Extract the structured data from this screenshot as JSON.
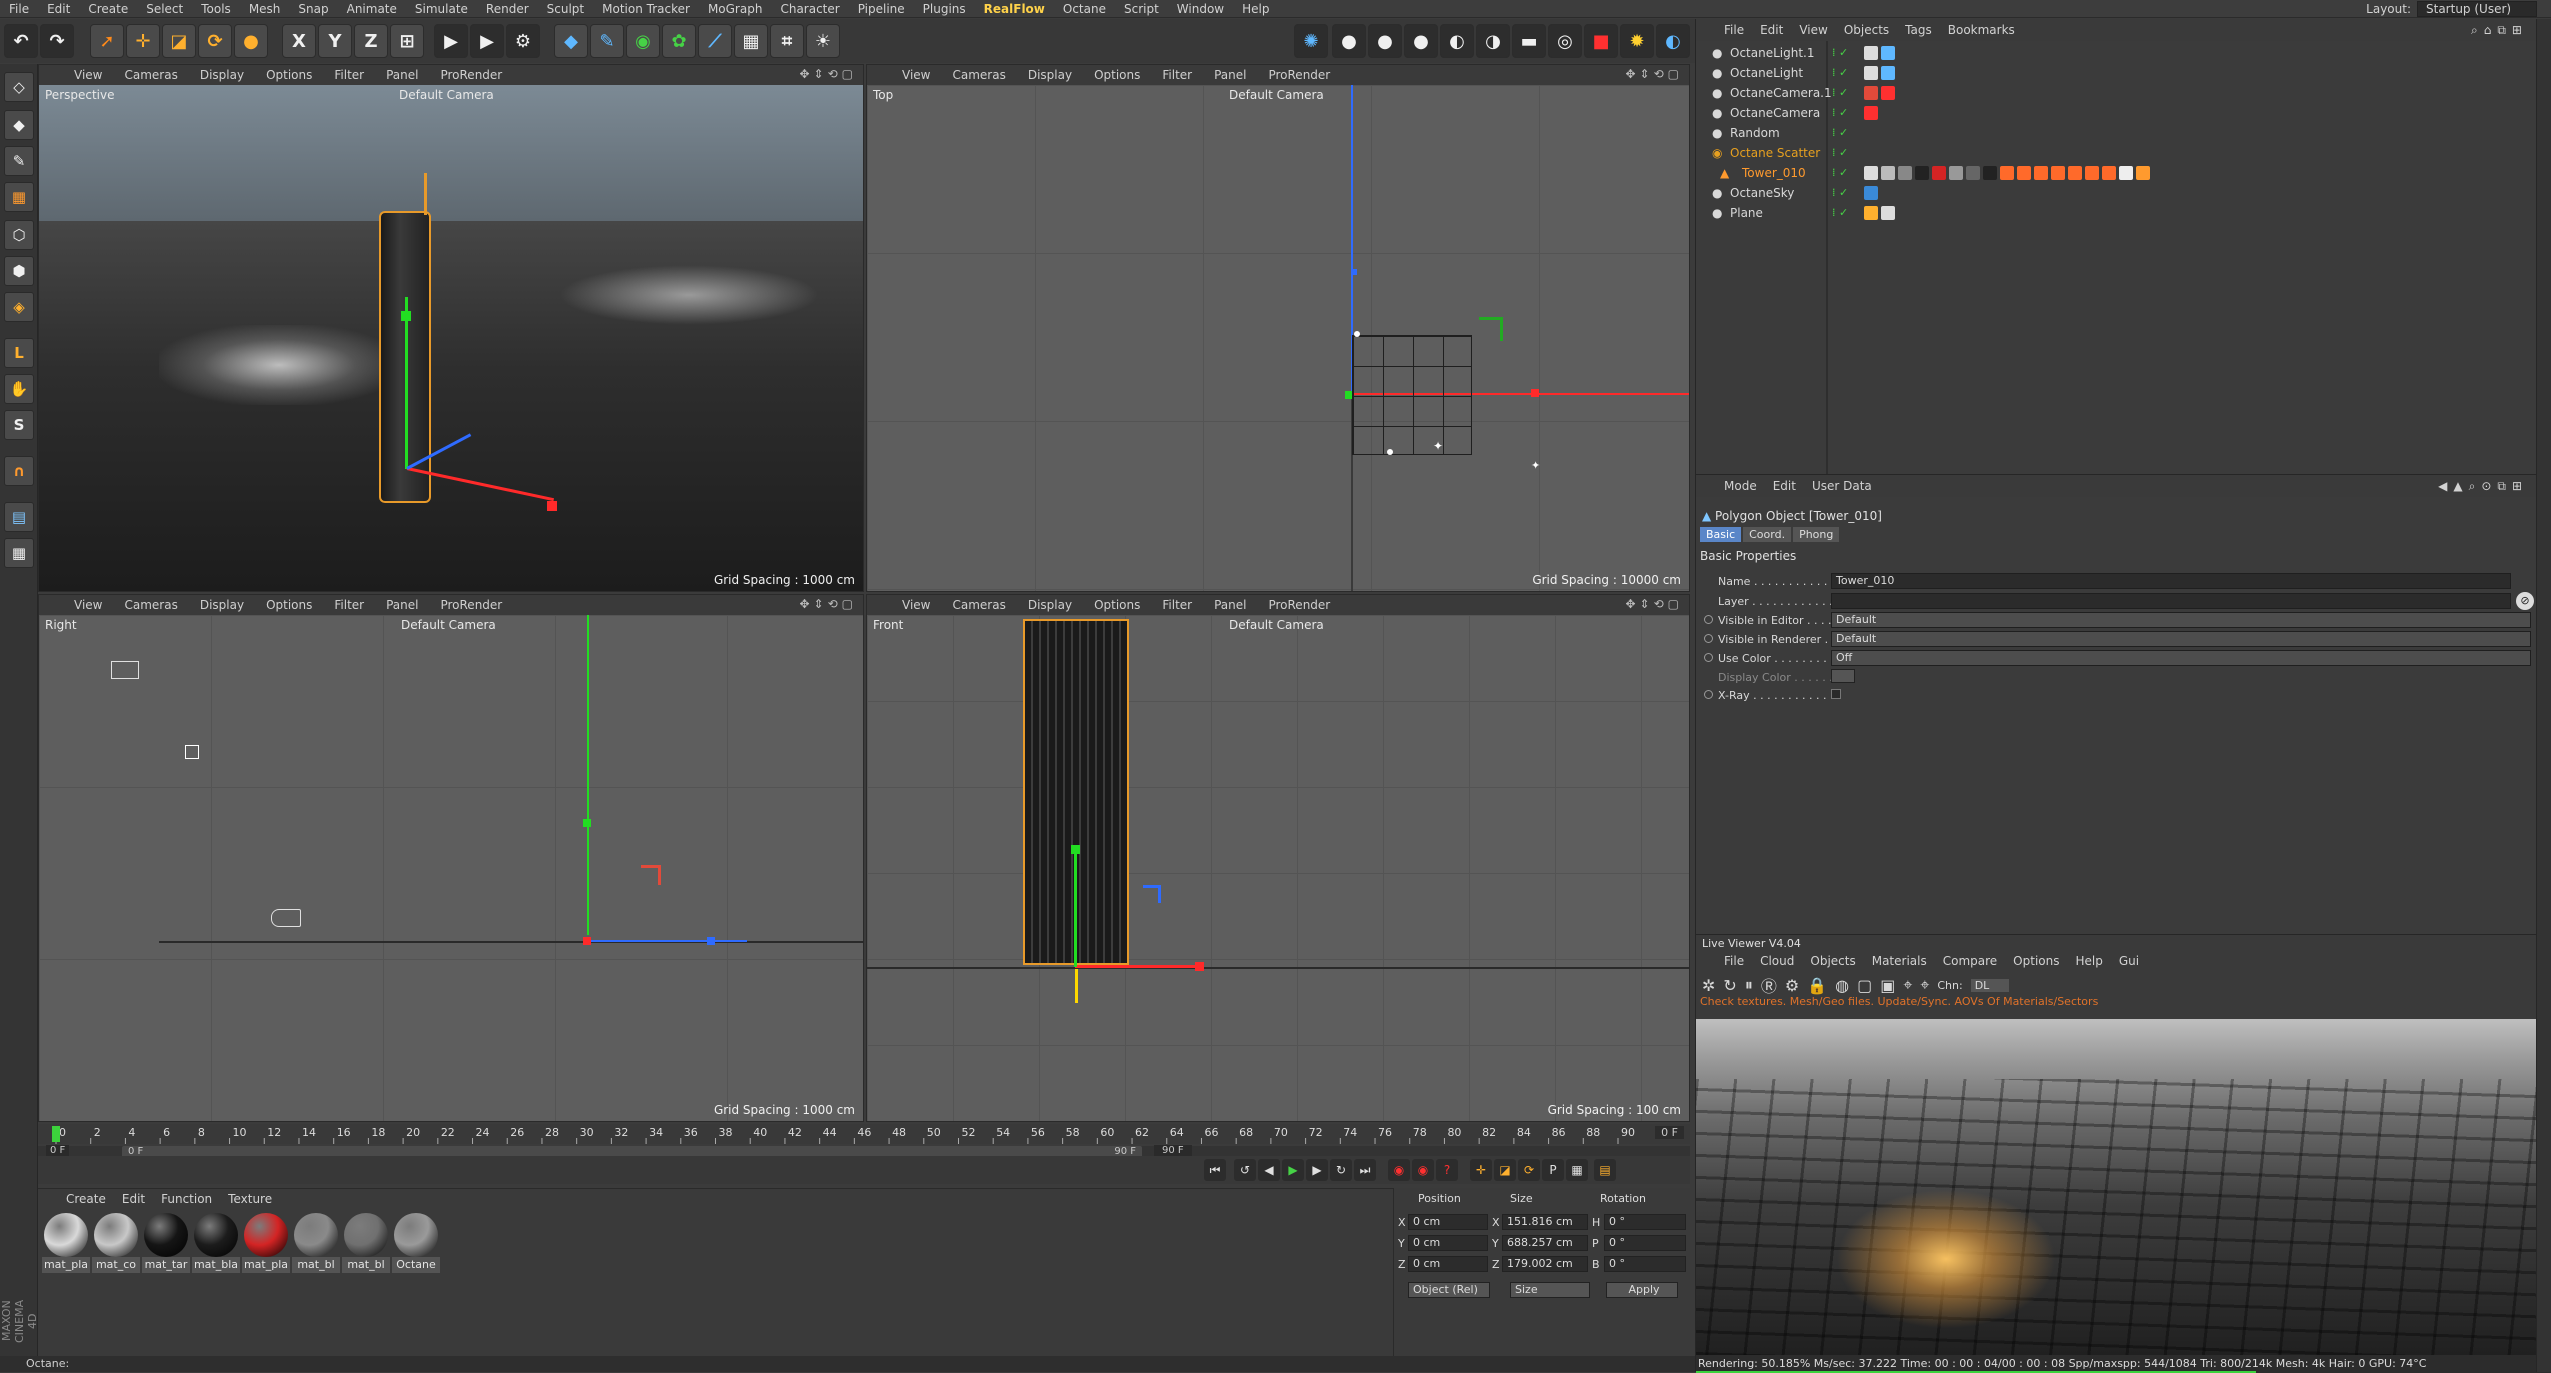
{
  "menubar": {
    "items": [
      "File",
      "Edit",
      "Create",
      "Select",
      "Tools",
      "Mesh",
      "Snap",
      "Animate",
      "Simulate",
      "Render",
      "Sculpt",
      "Motion Tracker",
      "MoGraph",
      "Character",
      "Pipeline",
      "Plugins",
      "RealFlow",
      "Octane",
      "Script",
      "Window",
      "Help"
    ],
    "highlight": "RealFlow",
    "layout_label": "Layout:",
    "layout_value": "Startup (User)"
  },
  "viewport_menu": [
    "View",
    "Cameras",
    "Display",
    "Options",
    "Filter",
    "Panel",
    "ProRender"
  ],
  "viewports": {
    "perspective": {
      "name": "Perspective",
      "camera": "Default Camera",
      "grid": "Grid Spacing : 1000 cm"
    },
    "top": {
      "name": "Top",
      "camera": "Default Camera",
      "grid": "Grid Spacing : 10000 cm"
    },
    "right": {
      "name": "Right",
      "camera": "Default Camera",
      "grid": "Grid Spacing : 1000 cm"
    },
    "front": {
      "name": "Front",
      "camera": "Default Camera",
      "grid": "Grid Spacing : 100 cm"
    }
  },
  "timeline": {
    "ticks": [
      "0",
      "2",
      "4",
      "6",
      "8",
      "10",
      "12",
      "14",
      "16",
      "18",
      "20",
      "22",
      "24",
      "26",
      "28",
      "30",
      "32",
      "34",
      "36",
      "38",
      "40",
      "42",
      "44",
      "46",
      "48",
      "50",
      "52",
      "54",
      "56",
      "58",
      "60",
      "62",
      "64",
      "66",
      "68",
      "70",
      "72",
      "74",
      "76",
      "78",
      "80",
      "82",
      "84",
      "86",
      "88",
      "90"
    ],
    "current_frame": "0 F",
    "start_frame": "0 F",
    "range_start": "0 F",
    "range_end": "90 F",
    "end_frame": "90 F",
    "playhead_fraction": 0.0
  },
  "materials": {
    "menu": [
      "Create",
      "Edit",
      "Function",
      "Texture"
    ],
    "items": [
      {
        "label": "mat_pla",
        "color": "#d9d9d9"
      },
      {
        "label": "mat_co",
        "color": "#c8c8c8"
      },
      {
        "label": "mat_tar",
        "color": "#151515"
      },
      {
        "label": "mat_bla",
        "color": "#1c1c1c"
      },
      {
        "label": "mat_pla",
        "color": "#d42424"
      },
      {
        "label": "mat_bl",
        "color": "#8a8a8a"
      },
      {
        "label": "mat_bl",
        "color": "#707070"
      },
      {
        "label": "Octane",
        "color": "#9a9a9a"
      }
    ]
  },
  "coordinates": {
    "headers": [
      "Position",
      "Size",
      "Rotation"
    ],
    "rows": [
      {
        "axis": "X",
        "pos": "0 cm",
        "size_axis": "X",
        "size": "151.816 cm",
        "rot_axis": "H",
        "rot": "0 °"
      },
      {
        "axis": "Y",
        "pos": "0 cm",
        "size_axis": "Y",
        "size": "688.257 cm",
        "rot_axis": "P",
        "rot": "0 °"
      },
      {
        "axis": "Z",
        "pos": "0 cm",
        "size_axis": "Z",
        "size": "179.002 cm",
        "rot_axis": "B",
        "rot": "0 °"
      }
    ],
    "mode": "Object (Rel)",
    "size_mode": "Size",
    "apply": "Apply"
  },
  "status_bar": "Octane:",
  "object_manager": {
    "menu": [
      "File",
      "Edit",
      "View",
      "Objects",
      "Tags",
      "Bookmarks"
    ],
    "objects": [
      {
        "name": "OctaneLight.1",
        "color": "#d8d8d8"
      },
      {
        "name": "OctaneLight",
        "color": "#d8d8d8"
      },
      {
        "name": "OctaneCamera.1",
        "color": "#d8d8d8"
      },
      {
        "name": "OctaneCamera",
        "color": "#d8d8d8"
      },
      {
        "name": "Random",
        "color": "#d8d8d8"
      },
      {
        "name": "Octane Scatter",
        "color": "#e6a020"
      },
      {
        "name": "Tower_010",
        "color": "#ff9a2e"
      },
      {
        "name": "OctaneSky",
        "color": "#d8d8d8"
      },
      {
        "name": "Plane",
        "color": "#d8d8d8"
      }
    ]
  },
  "attributes": {
    "menu": [
      "Mode",
      "Edit",
      "User Data"
    ],
    "title": "Polygon Object [Tower_010]",
    "tabs": [
      "Basic",
      "Coord.",
      "Phong"
    ],
    "active_tab": "Basic",
    "section": "Basic Properties",
    "fields": [
      {
        "label": "Name . . . . . . . . . . . . .",
        "value": "Tower_010"
      },
      {
        "label": "Layer . . . . . . . . . . . . .",
        "value": ""
      },
      {
        "label": "Visible in Editor . . . .",
        "value": "Default"
      },
      {
        "label": "Visible in Renderer . .",
        "value": "Default"
      },
      {
        "label": "Use Color . . . . . . . .",
        "value": "Off"
      },
      {
        "label": "Display Color . . . . . .",
        "value": ""
      },
      {
        "label": "X-Ray . . . . . . . . . . . .",
        "value": ""
      }
    ]
  },
  "live_viewer": {
    "title": "Live Viewer V4.04",
    "menu": [
      "File",
      "Cloud",
      "Objects",
      "Materials",
      "Compare",
      "Options",
      "Help",
      "Gui"
    ],
    "chn_label": "Chn:",
    "chn_value": "DL",
    "warning": "Check textures. Mesh/Geo files. Update/Sync. AOVs Of Materials/Sectors",
    "status": "Rendering: 50.185%   Ms/sec: 37.222   Time: 00 : 00 : 04/00 : 00 : 08   Spp/maxspp: 544/1084  Tri: 800/214k   Mesh: 4k   Hair: 0   GPU:  74°C"
  },
  "colors": {
    "accent": "#ffb02e",
    "selection": "#e89a2a",
    "axis_x": "#ff2a2a",
    "axis_y": "#22dd22",
    "axis_z": "#2f6bff"
  }
}
